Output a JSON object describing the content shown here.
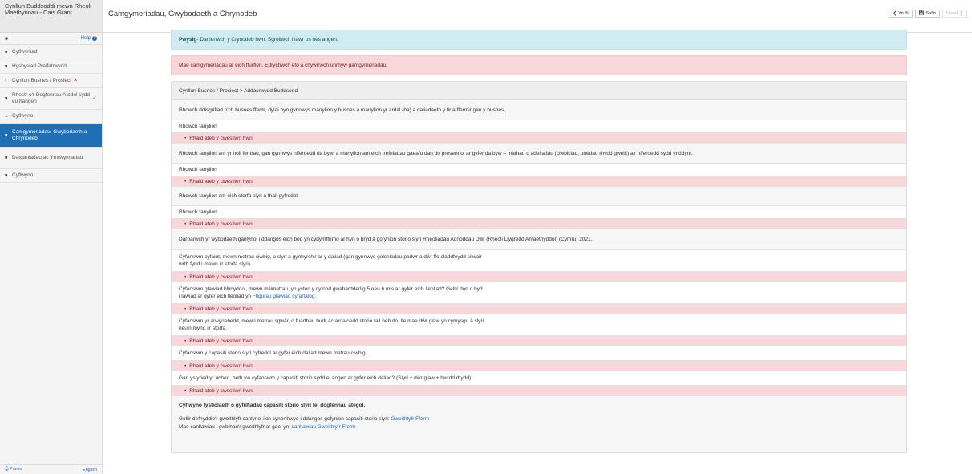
{
  "sidebar": {
    "app_title": "Cynllun Buddsoddi mewn Rheoli Maethynnau - Cais Grant",
    "user_icon": "user-icon",
    "help_label": "Help",
    "items": [
      {
        "label": "Cyflwyniad",
        "icon": "doc-icon",
        "status": ""
      },
      {
        "label": "Hysbysiad Preifatrwydd",
        "icon": "doc-icon",
        "status": ""
      },
      {
        "label": "Cynllun Busnes / Prosiect",
        "icon": "chevron-right-icon",
        "status": "error"
      },
      {
        "label": "Rhestr o'r Dogfennau Atodol sydd eu hangen",
        "icon": "doc-icon",
        "status": "ok"
      },
      {
        "label": "Cyflwyno",
        "icon": "chevron-down-icon",
        "status": ""
      },
      {
        "label": "Camgymeriadau, Gwybodaeth a Chrynodeb",
        "icon": "doc-icon",
        "status": "active"
      },
      {
        "label": "Datganiadau ac Ymrwymiadau",
        "icon": "doc-icon",
        "status": ""
      },
      {
        "label": "Cyflwyno",
        "icon": "doc-icon",
        "status": ""
      }
    ],
    "footer": {
      "print": "Printio",
      "language": "English"
    }
  },
  "header": {
    "title": "Camgymeriadau, Gwybodaeth a Chrynodeb",
    "back_label": "Yn ôl",
    "save_label": "Safio",
    "next_label": "Nesaf"
  },
  "alerts": {
    "info_bold": "Pwysig",
    "info_text": " - Darllenwch y Crynodeb hwn. Sgroliwch i lawr os oes angen.",
    "error_text": "Mae camgymeriadau ar eich ffurflen. Edrychwch eto a chywirwch unrhyw gamgymeriadau."
  },
  "panel": {
    "breadcrumb": "Cynllun Busnes / Prosiect > Addasrwydd Buddsoddi",
    "error_text": "Rhaid ateb y cwestiwn hwn.",
    "q1": "Rhowch ddisgrifiad o'ch busnes fferm, dylai hyn gynnwys manylion y busnes a manylion yr ardal (ha) a daliadaeth y tir a ffermir gan y busnes.",
    "details_label": "Rhowch fanylion",
    "q2": "Rhowch fanylion am yr holl fentrau, gan gynnwys niferoedd da byw, a manylion am eich trefniadau gaeafu dan do presennol ar gyfer da byw – mathau o adeiladau (ciwbiclau, unedau rhydd gwellt) a'r niferoedd sydd ynddynt.",
    "q3": "Rhowch fanylion am eich storfa slyri a thail gyfredol.",
    "q4": "Darparwch yr wybodaeth ganlynol i ddangos eich bod yn cydymffurfio ar hyn o bryd â gofynion storio slyri Rheoliadau Adnoddau Dŵr (Rheoli Llygredd Amaethyddol) (Cymru) 2021.",
    "q5_line1": "Cyfanswm cyfaint, mewn metrau ciwbig, o slyri a gynhyrchir ar y daliad (gan gynnwys golchiadau parlwr a dŵr ffo claddfeydd silwair",
    "q5_line2": "wrth fynd i mewn i'r storfa slyri).",
    "q6_line1": "Cyfanswm glawiad blynyddol, mewn milimetrau, yn ystod y cyfnod gwaharddedig 5 neu 6 mis ar gyfer eich lleoliad? Gellir dod o hyd",
    "q6_line2": "i lawiad ar gyfer eich lleoliad yn ",
    "q6_link": "Ffigurau glawiad cyfartalog",
    "q7_line1": "Cyfanswm yr arwynebedd, mewn metrau sgwâr, o fuarthau budr ac ardaloedd storio tail heb do, lle mae dŵr glaw yn cymysgu â slyri",
    "q7_line2": "neu'n mynd i'r storfa.",
    "q8": "Cyfanswm y capasiti storio slyri cyfredol ar gyfer eich daliad mewn metrau ciwbig.",
    "q9": "Gan ystyried yr uchod, beth yw cyfanswm y capasiti storio sydd ei angen ar gyfer eich daliad? (Slyri + dŵr glaw + bwrdd rhydd)",
    "evidence_title": "Cyflwyno tystiolaeth o gyfrifiadau capasiti storio slyri fel dogfennau ategol.",
    "evidence_line1": "Gellir defnyddio'r gweithlyfr canlynol i'ch cynorthwyo i ddangos gofynion capasiti storio slyri: ",
    "evidence_link1": "Gweithlyfr Fferm",
    "evidence_line2": "Mae canllawiau i gwblhau'r gweithlyfr ar gael yn: ",
    "evidence_link2": "canllawiau Gweithlyfr Fferm"
  },
  "colors": {
    "accent": "#1f6fb7",
    "error_bg": "#f8d7da",
    "info_bg": "#d1ecf1"
  }
}
